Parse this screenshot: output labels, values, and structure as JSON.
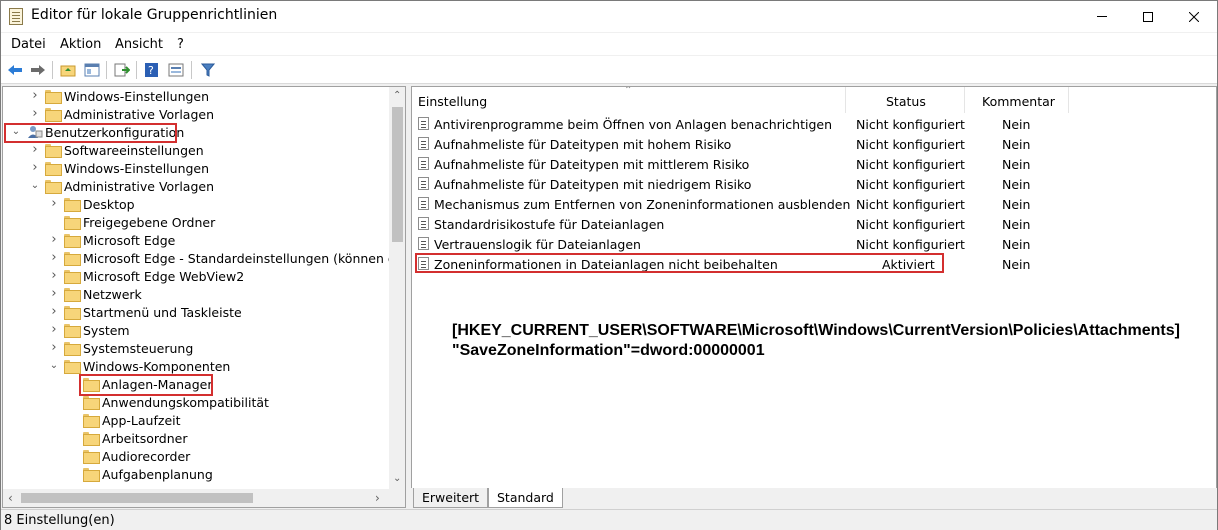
{
  "window": {
    "title": "Editor für lokale Gruppenrichtlinien"
  },
  "menu": {
    "items": [
      "Datei",
      "Aktion",
      "Ansicht",
      "?"
    ]
  },
  "tree": {
    "items": [
      {
        "label": "Windows-Einstellungen",
        "level": 1,
        "expanded": false,
        "icon": "folder"
      },
      {
        "label": "Administrative Vorlagen",
        "level": 1,
        "expanded": false,
        "icon": "folder"
      },
      {
        "label": "Benutzerkonfiguration",
        "level": 0,
        "expanded": true,
        "icon": "user-config"
      },
      {
        "label": "Softwareeinstellungen",
        "level": 1,
        "expanded": false,
        "icon": "folder"
      },
      {
        "label": "Windows-Einstellungen",
        "level": 1,
        "expanded": false,
        "icon": "folder"
      },
      {
        "label": "Administrative Vorlagen",
        "level": 1,
        "expanded": true,
        "icon": "folder"
      },
      {
        "label": "Desktop",
        "level": 2,
        "expanded": false,
        "icon": "folder"
      },
      {
        "label": "Freigegebene Ordner",
        "level": 2,
        "expanded": null,
        "icon": "folder"
      },
      {
        "label": "Microsoft Edge",
        "level": 2,
        "expanded": false,
        "icon": "folder"
      },
      {
        "label": "Microsoft Edge - Standardeinstellungen (können durch",
        "level": 2,
        "expanded": false,
        "icon": "folder"
      },
      {
        "label": "Microsoft Edge WebView2",
        "level": 2,
        "expanded": false,
        "icon": "folder"
      },
      {
        "label": "Netzwerk",
        "level": 2,
        "expanded": false,
        "icon": "folder"
      },
      {
        "label": "Startmenü und Taskleiste",
        "level": 2,
        "expanded": false,
        "icon": "folder"
      },
      {
        "label": "System",
        "level": 2,
        "expanded": false,
        "icon": "folder"
      },
      {
        "label": "Systemsteuerung",
        "level": 2,
        "expanded": false,
        "icon": "folder"
      },
      {
        "label": "Windows-Komponenten",
        "level": 2,
        "expanded": true,
        "icon": "folder"
      },
      {
        "label": "Anlagen-Manager",
        "level": 3,
        "expanded": null,
        "icon": "folder-open"
      },
      {
        "label": "Anwendungskompatibilität",
        "level": 3,
        "expanded": null,
        "icon": "folder"
      },
      {
        "label": "App-Laufzeit",
        "level": 3,
        "expanded": null,
        "icon": "folder"
      },
      {
        "label": "Arbeitsordner",
        "level": 3,
        "expanded": null,
        "icon": "folder"
      },
      {
        "label": "Audiorecorder",
        "level": 3,
        "expanded": null,
        "icon": "folder"
      },
      {
        "label": "Aufgabenplanung",
        "level": 3,
        "expanded": null,
        "icon": "folder"
      }
    ]
  },
  "list": {
    "columns": {
      "setting": "Einstellung",
      "status": "Status",
      "comment": "Kommentar"
    },
    "rows": [
      {
        "name": "Antivirenprogramme beim Öffnen von Anlagen benachrichtigen",
        "status": "Nicht konfiguriert",
        "comment": "Nein"
      },
      {
        "name": "Aufnahmeliste für Dateitypen mit hohem Risiko",
        "status": "Nicht konfiguriert",
        "comment": "Nein"
      },
      {
        "name": "Aufnahmeliste für Dateitypen mit mittlerem Risiko",
        "status": "Nicht konfiguriert",
        "comment": "Nein"
      },
      {
        "name": "Aufnahmeliste für Dateitypen mit niedrigem Risiko",
        "status": "Nicht konfiguriert",
        "comment": "Nein"
      },
      {
        "name": "Mechanismus zum Entfernen von Zoneninformationen ausblenden",
        "status": "Nicht konfiguriert",
        "comment": "Nein"
      },
      {
        "name": "Standardrisikostufe für Dateianlagen",
        "status": "Nicht konfiguriert",
        "comment": "Nein"
      },
      {
        "name": "Vertrauenslogik für Dateianlagen",
        "status": "Nicht konfiguriert",
        "comment": "Nein"
      },
      {
        "name": "Zoneninformationen in Dateianlagen nicht beibehalten",
        "status": "Aktiviert",
        "comment": "Nein"
      }
    ]
  },
  "annotation": {
    "line1": "[HKEY_CURRENT_USER\\SOFTWARE\\Microsoft\\Windows\\CurrentVersion\\Policies\\Attachments]",
    "line2": "\"SaveZoneInformation\"=dword:00000001"
  },
  "tabs": [
    "Erweitert",
    "Standard"
  ],
  "statusbar": {
    "text": "8 Einstellung(en)"
  },
  "colors": {
    "highlight": "#d32f2f",
    "folder": "#f7d57a"
  }
}
